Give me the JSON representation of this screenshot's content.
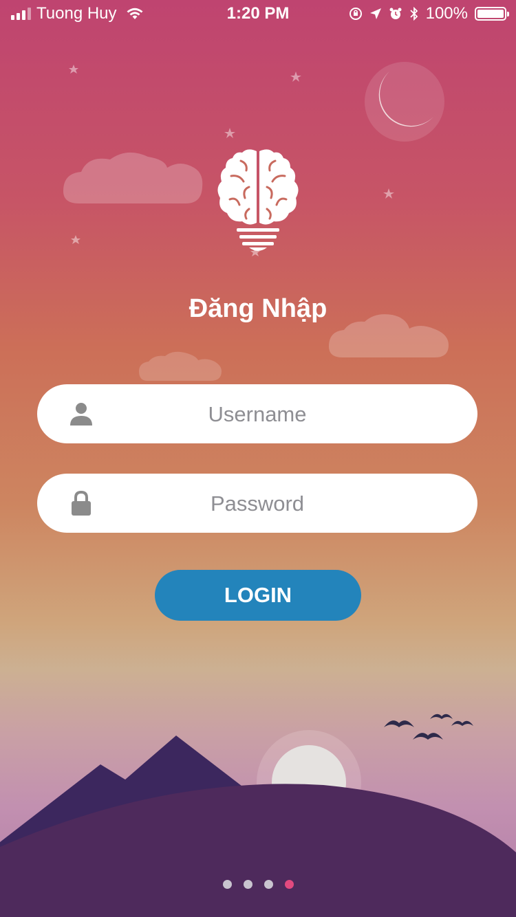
{
  "status_bar": {
    "carrier": "Tuong Huy",
    "time": "1:20 PM",
    "battery": "100%"
  },
  "login": {
    "title": "Đăng Nhập",
    "username_placeholder": "Username",
    "username_value": "",
    "password_placeholder": "Password",
    "password_value": "",
    "login_label": "LOGIN"
  },
  "page_indicator": {
    "count": 4,
    "active_index": 3
  },
  "icons": [
    "signal-icon",
    "wifi-icon",
    "orientation-lock-icon",
    "location-arrow-icon",
    "alarm-icon",
    "bluetooth-icon",
    "battery-icon",
    "brain-logo-icon",
    "user-icon",
    "lock-icon"
  ],
  "colors": {
    "gradient_top": "#bf4470",
    "gradient_middle": "#cd8560",
    "login_button": "#2384bb",
    "active_dot": "#e24a7f",
    "inactive_dot": "#c9c4cf",
    "hill": "#4e2a5c",
    "mountain": "#3c275e"
  }
}
